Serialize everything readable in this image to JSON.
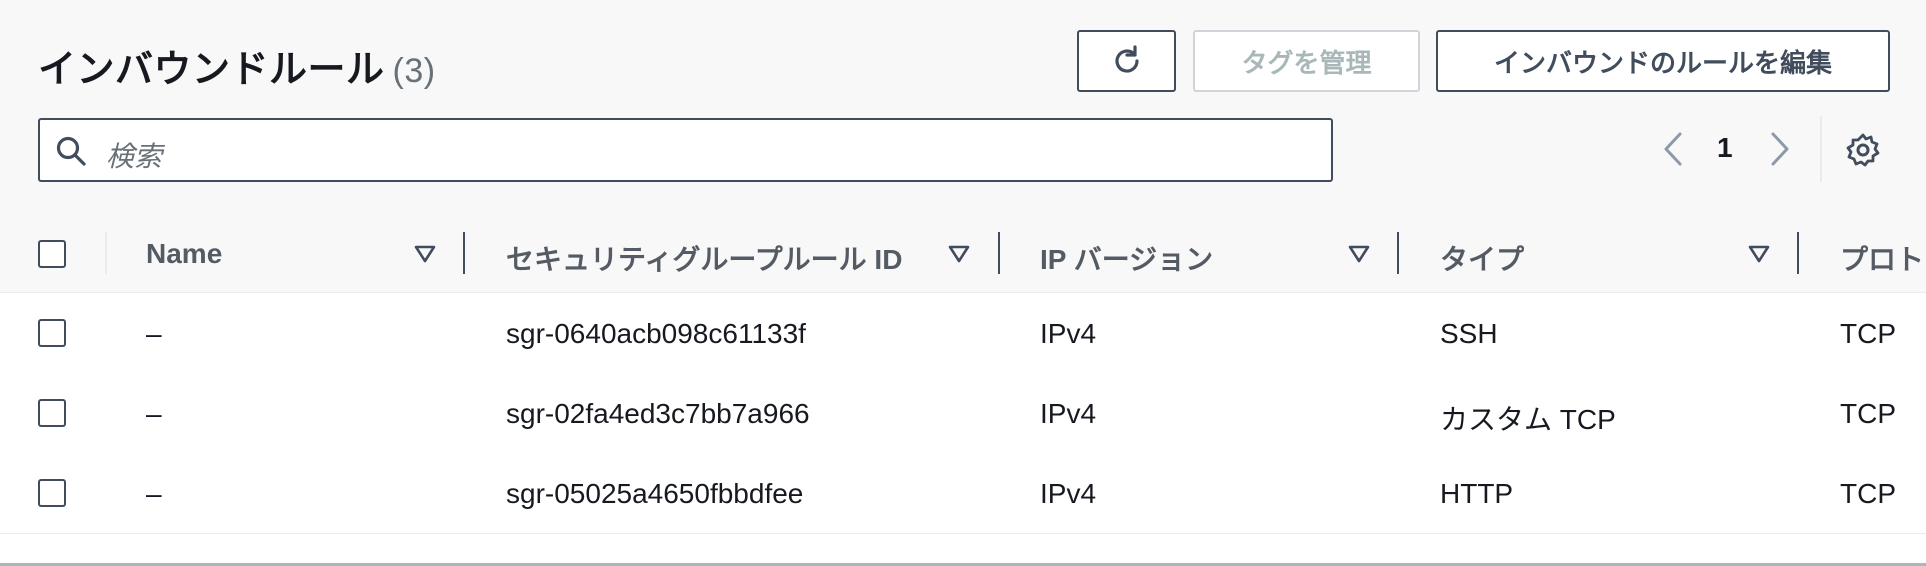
{
  "header": {
    "title": "インバウンドルール",
    "count": "(3)",
    "buttons": {
      "refresh_icon": "refresh-icon",
      "manage_tags": "タグを管理",
      "edit_inbound_rules": "インバウンドのルールを編集"
    },
    "search": {
      "placeholder": "検索",
      "icon": "search-icon"
    },
    "pagination": {
      "current_page": "1",
      "prev_icon": "chevron-left-icon",
      "next_icon": "chevron-right-icon"
    },
    "settings_icon": "gear-icon"
  },
  "table": {
    "columns": [
      {
        "label": "Name"
      },
      {
        "label": "セキュリティグループルール ID"
      },
      {
        "label": "IP バージョン"
      },
      {
        "label": "タイプ"
      },
      {
        "label": "プロト"
      }
    ],
    "rows": [
      {
        "name": "–",
        "rule_id": "sgr-0640acb098c61133f",
        "ip_version": "IPv4",
        "type": "SSH",
        "protocol": "TCP"
      },
      {
        "name": "–",
        "rule_id": "sgr-02fa4ed3c7bb7a966",
        "ip_version": "IPv4",
        "type": "カスタム TCP",
        "protocol": "TCP"
      },
      {
        "name": "–",
        "rule_id": "sgr-05025a4650fbbdfee",
        "ip_version": "IPv4",
        "type": "HTTP",
        "protocol": "TCP"
      }
    ]
  },
  "colors": {
    "text": "#16191f",
    "border": "#414d5c",
    "muted": "#687078",
    "disabled": "#aab7b8"
  }
}
